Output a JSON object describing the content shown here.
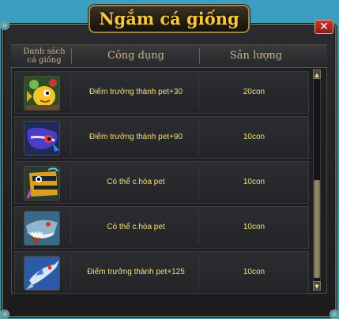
{
  "dialog": {
    "title": "Ngắm cá giống",
    "close_label": "✕"
  },
  "table": {
    "headers": {
      "list": "Danh sách cá giống",
      "use": "Công dụng",
      "yield": "Sản lượng"
    },
    "rows": [
      {
        "icon": "yellow-fish-icon",
        "use": "Điếm trưởng thành pet+30",
        "yield": "20con"
      },
      {
        "icon": "blue-fish-icon",
        "use": "Điếm trưởng thành pet+90",
        "yield": "10con"
      },
      {
        "icon": "angler-fish-icon",
        "use": "Có thể c.hóa pet",
        "yield": "10con"
      },
      {
        "icon": "shark-icon",
        "use": "Có thể c.hóa pet",
        "yield": "10con"
      },
      {
        "icon": "swordfish-icon",
        "use": "Điếm trưởng thành pet+125",
        "yield": "10con"
      }
    ]
  },
  "scrollbar": {
    "up": "▲",
    "down": "▼"
  },
  "colors": {
    "title": "#f5c640",
    "text": "#f2de7a",
    "close": "#c8382d"
  }
}
